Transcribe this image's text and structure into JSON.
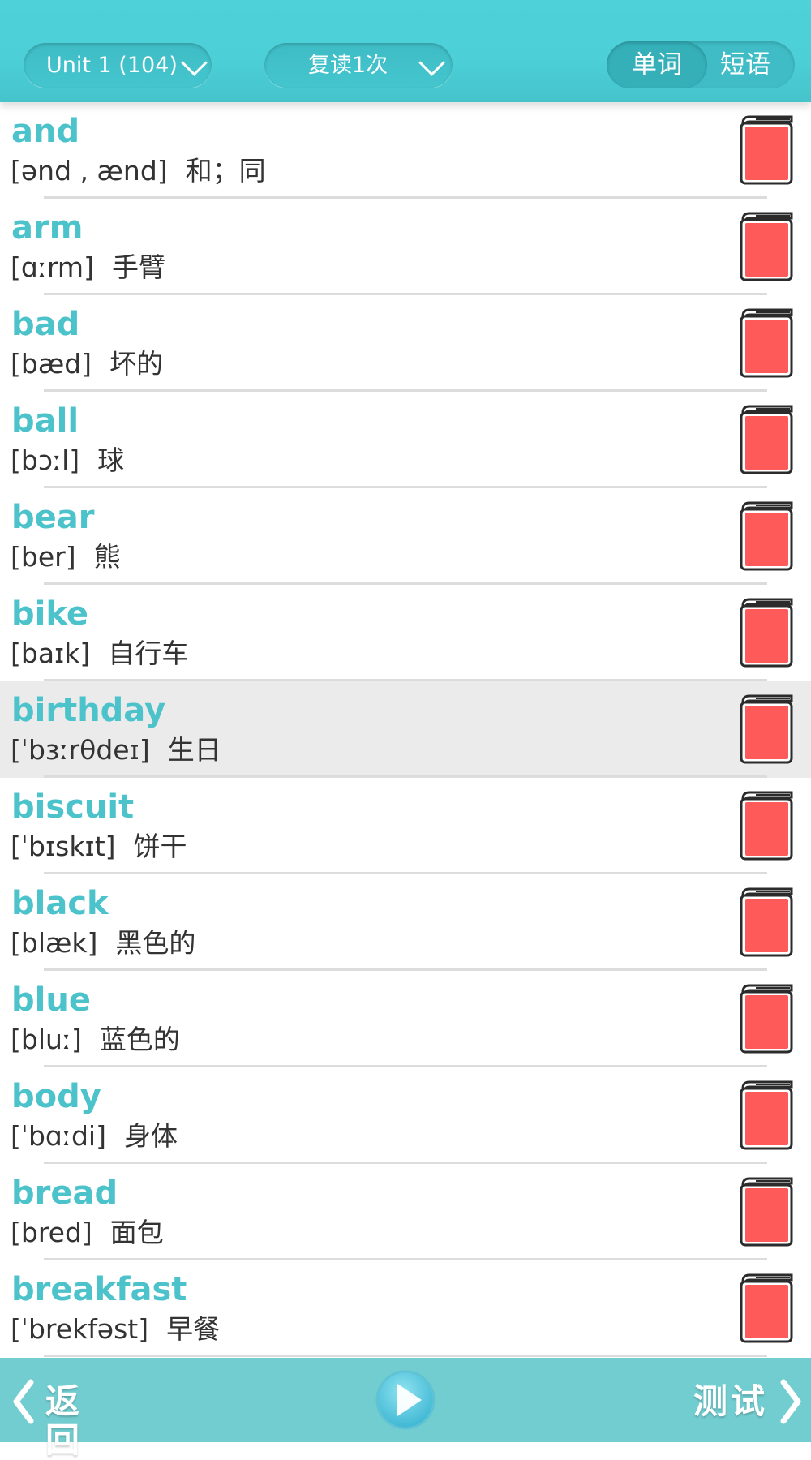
{
  "header": {
    "unit_select": "Unit 1 (104)",
    "repeat_select": "复读1次",
    "tabs": [
      {
        "label": "单词",
        "active": true
      },
      {
        "label": "短语",
        "active": false
      }
    ]
  },
  "words": [
    {
      "word": "and",
      "phonetic": "[ənd , ænd]",
      "meaning": "和；同",
      "selected": false
    },
    {
      "word": "arm",
      "phonetic": "[ɑːrm]",
      "meaning": "手臂",
      "selected": false
    },
    {
      "word": "bad",
      "phonetic": "[bæd]",
      "meaning": "坏的",
      "selected": false
    },
    {
      "word": "ball",
      "phonetic": "[bɔːl]",
      "meaning": "球",
      "selected": false
    },
    {
      "word": "bear",
      "phonetic": "[ber]",
      "meaning": "熊",
      "selected": false
    },
    {
      "word": "bike",
      "phonetic": "[baɪk]",
      "meaning": "自行车",
      "selected": false
    },
    {
      "word": "birthday",
      "phonetic": "[ˈbɜːrθdeɪ]",
      "meaning": "生日",
      "selected": true
    },
    {
      "word": "biscuit",
      "phonetic": "[ˈbɪskɪt]",
      "meaning": "饼干",
      "selected": false
    },
    {
      "word": "black",
      "phonetic": "[blæk]",
      "meaning": "黑色的",
      "selected": false
    },
    {
      "word": "blue",
      "phonetic": "[bluː]",
      "meaning": "蓝色的",
      "selected": false
    },
    {
      "word": "body",
      "phonetic": "[ˈbɑːdi]",
      "meaning": "身体",
      "selected": false
    },
    {
      "word": "bread",
      "phonetic": "[bred]",
      "meaning": "面包",
      "selected": false
    },
    {
      "word": "breakfast",
      "phonetic": "[ˈbrekfəst]",
      "meaning": "早餐",
      "selected": false
    }
  ],
  "footer": {
    "back_label": "返回",
    "test_label": "测试"
  },
  "colors": {
    "accent": "#4cc3cb",
    "header": "#4fd1d9",
    "footer": "#72cdd0",
    "book": "#ff5a5a",
    "selected_row": "#ebebeb"
  },
  "icons": {
    "row_action": "book-icon",
    "play": "play-icon",
    "back": "chevron-left-icon",
    "forward": "chevron-right-icon",
    "dropdown": "chevron-down-icon"
  }
}
